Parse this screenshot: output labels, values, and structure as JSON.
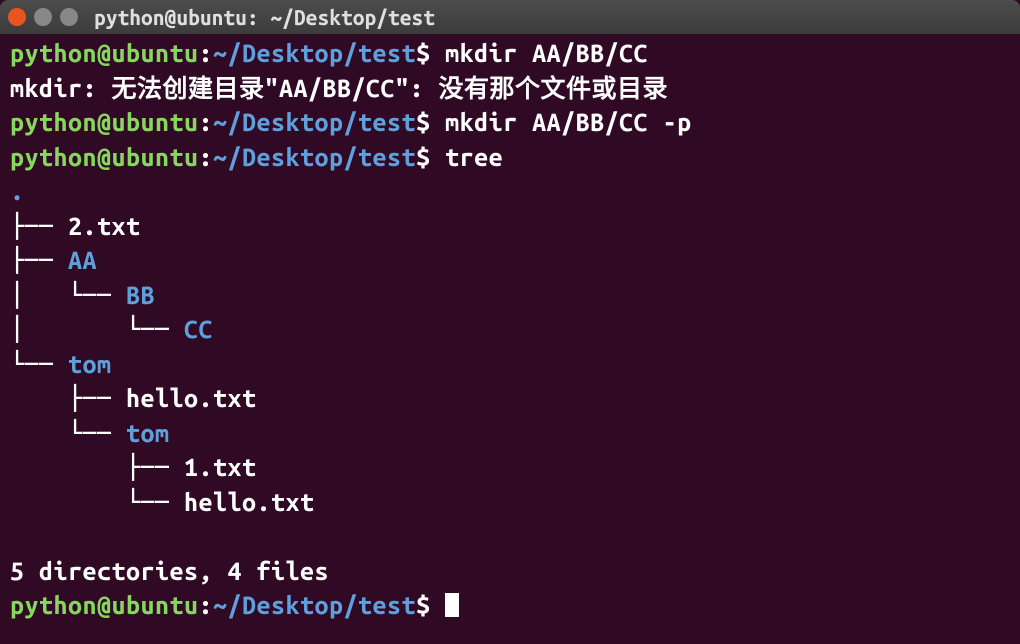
{
  "titlebar": {
    "title": "python@ubuntu: ~/Desktop/test"
  },
  "prompt": {
    "user_host": "python@ubuntu",
    "colon": ":",
    "path": "~/Desktop/test",
    "dollar": "$"
  },
  "lines": {
    "cmd1": " mkdir AA/BB/CC",
    "error": "mkdir: 无法创建目录\"AA/BB/CC\": 没有那个文件或目录",
    "cmd2": " mkdir AA/BB/CC -p",
    "cmd3": " tree"
  },
  "tree": {
    "root": ".",
    "l1": "├── ",
    "l1_file": "2.txt",
    "l2": "├── ",
    "l2_dir": "AA",
    "l3": "│   └── ",
    "l3_dir": "BB",
    "l4": "│       └── ",
    "l4_dir": "CC",
    "l5": "└── ",
    "l5_dir": "tom",
    "l6": "    ├── ",
    "l6_file": "hello.txt",
    "l7": "    └── ",
    "l7_dir": "tom",
    "l8": "        ├── ",
    "l8_file": "1.txt",
    "l9": "        └── ",
    "l9_file": "hello.txt"
  },
  "summary": "5 directories, 4 files"
}
